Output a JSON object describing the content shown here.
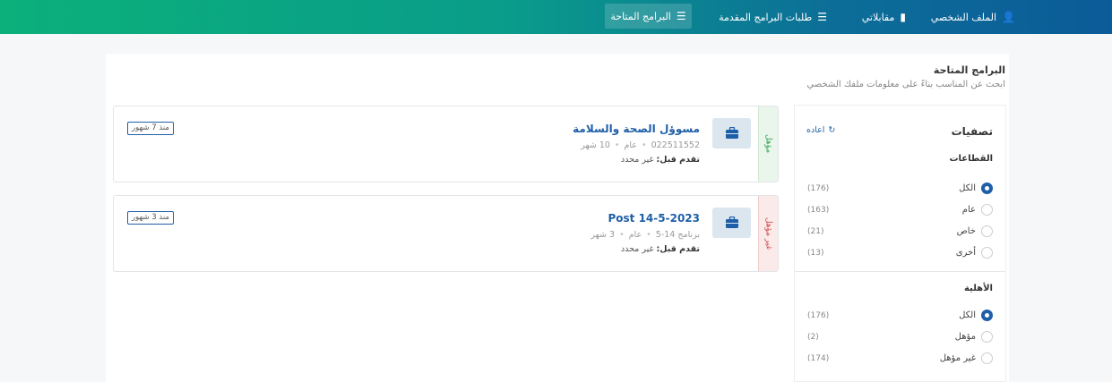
{
  "nav": {
    "profile": "الملف الشخصي",
    "interviews": "مقابلاتي",
    "requests": "طلبات البرامج المقدمة",
    "programs": "البرامج المتاحة"
  },
  "header": {
    "title": "البرامج المتاحة",
    "subtitle": "ابحث عن المناسب بناءً على معلومات ملفك الشخصي"
  },
  "cards": [
    {
      "status": "مؤهل",
      "title": "مسوؤل الصحة والسلامة",
      "code": "022511552",
      "sector": "عام",
      "duration": "10 شهر",
      "apply_label": "تقدم قبل:",
      "apply_value": "غير محدد",
      "posted": "منذ 7 شهور"
    },
    {
      "status": "غير مؤهل",
      "title": "Post 14-5-2023",
      "code": "برنامج 14-5",
      "sector": "عام",
      "duration": "3 شهر",
      "apply_label": "تقدم قبل:",
      "apply_value": "غير محدد",
      "posted": "منذ 3 شهور"
    }
  ],
  "filters": {
    "title": "تصفيات",
    "reset": "اعاده",
    "sectors_title": "القطاعات",
    "sectors": [
      {
        "label": "الكل",
        "count": "(176)",
        "selected": true
      },
      {
        "label": "عام",
        "count": "(163)",
        "selected": false
      },
      {
        "label": "خاص",
        "count": "(21)",
        "selected": false
      },
      {
        "label": "أخرى",
        "count": "(13)",
        "selected": false
      }
    ],
    "eligibility_title": "الأهلية",
    "eligibility": [
      {
        "label": "الكل",
        "count": "(176)",
        "selected": true
      },
      {
        "label": "مؤهل",
        "count": "(2)",
        "selected": false
      },
      {
        "label": "غير مؤهل",
        "count": "(174)",
        "selected": false
      }
    ]
  },
  "colors": {
    "accent": "#1f5fa8",
    "eligible": "#37a354",
    "not_eligible": "#d24a4a"
  }
}
